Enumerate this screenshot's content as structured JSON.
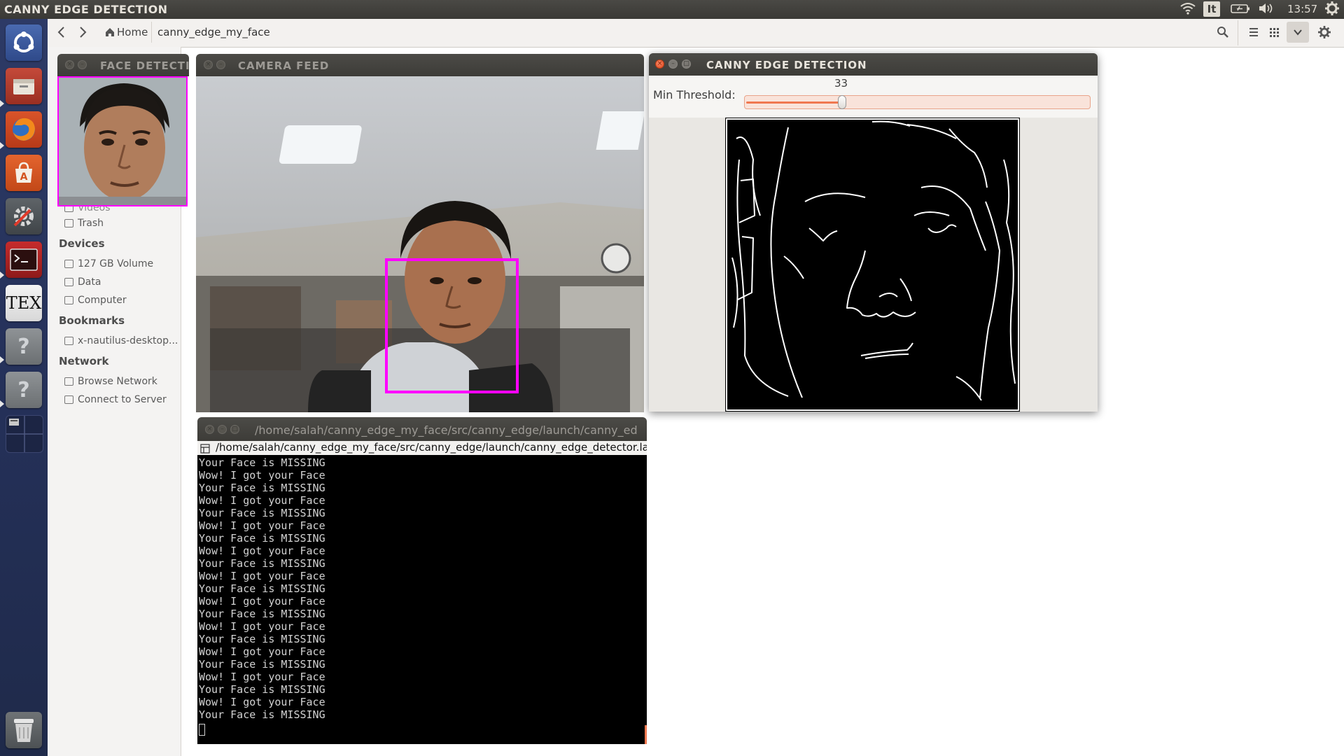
{
  "topbar": {
    "title": "CANNY EDGE DETECTION",
    "keyboard_layout": "It",
    "time": "13:57"
  },
  "launcher": {
    "items": [
      {
        "name": "dash-icon"
      },
      {
        "name": "files-icon"
      },
      {
        "name": "firefox-icon"
      },
      {
        "name": "software-center-icon"
      },
      {
        "name": "system-settings-icon"
      },
      {
        "name": "terminal-icon"
      },
      {
        "name": "texmaker-icon",
        "label": "TEX"
      },
      {
        "name": "unknown-app-icon"
      },
      {
        "name": "unknown-app-icon"
      },
      {
        "name": "workspace-switcher-icon"
      },
      {
        "name": "trash-icon"
      }
    ],
    "unknown_glyph": "?"
  },
  "file_manager": {
    "home_label": "Home",
    "current_folder": "canny_edge_my_face",
    "sidebar": {
      "partial_item": "Videos",
      "trash": "Trash",
      "devices_heading": "Devices",
      "devices": [
        "127 GB Volume",
        "Data",
        "Computer"
      ],
      "bookmarks_heading": "Bookmarks",
      "bookmarks": [
        "x-nautilus-desktop..."
      ],
      "network_heading": "Network",
      "network": [
        "Browse Network",
        "Connect to Server"
      ]
    }
  },
  "face_window": {
    "title": "FACE DETECTI"
  },
  "camera_window": {
    "title": "CAMERA FEED"
  },
  "canny_window": {
    "title": "CANNY EDGE DETECTION",
    "slider_label": "Min Threshold:",
    "slider_value": "33",
    "slider_fraction": 0.28
  },
  "terminal": {
    "title": "/home/salah/canny_edge_my_face/src/canny_edge/launch/canny_ed",
    "tab_path": "/home/salah/canny_edge_my_face/src/canny_edge/launch/canny_edge_detector.la",
    "lines": [
      "Your Face is MISSING",
      "Wow! I got your Face",
      "Your Face is MISSING",
      "Wow! I got your Face",
      "Your Face is MISSING",
      "Wow! I got your Face",
      "Your Face is MISSING",
      "Wow! I got your Face",
      "Your Face is MISSING",
      "Wow! I got your Face",
      "Your Face is MISSING",
      "Wow! I got your Face",
      "Your Face is MISSING",
      "Wow! I got your Face",
      "Your Face is MISSING",
      "Wow! I got your Face",
      "Your Face is MISSING",
      "Wow! I got your Face",
      "Your Face is MISSING",
      "Wow! I got your Face",
      "Your Face is MISSING"
    ]
  },
  "colors": {
    "face_box": "#ff00ff",
    "slider_fill": "#f07850",
    "close_button": "#e0461c",
    "launcher_bg": "#243058"
  }
}
